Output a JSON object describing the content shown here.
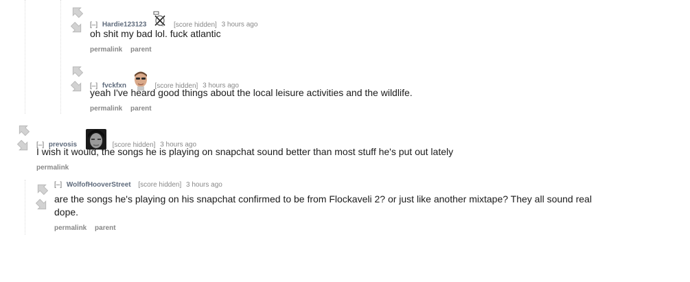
{
  "comments": [
    {
      "collapse": "[–]",
      "author": "Hardie123123",
      "flair_icon": "crossed-x-sketch-flair-icon",
      "score": "[score hidden]",
      "time": "3 hours ago",
      "body": "oh shit my bad lol. fuck atlantic",
      "buttons": [
        "permalink",
        "parent"
      ]
    },
    {
      "collapse": "[–]",
      "author": "fvckfxn",
      "flair_icon": "face-with-sunglasses-flair-icon",
      "score": "[score hidden]",
      "time": "3 hours ago",
      "body": "yeah I've heard good things about the local leisure activities and the wildlife.",
      "buttons": [
        "permalink",
        "parent"
      ]
    },
    {
      "collapse": "[–]",
      "author": "prevosis",
      "flair_icon": "hooded-face-flair-icon",
      "score": "[score hidden]",
      "time": "3 hours ago",
      "body": "I wish it would, the songs he is playing on snapchat sound better than most stuff he's put out lately",
      "buttons": [
        "permalink"
      ]
    },
    {
      "collapse": "[–]",
      "author": "WolfofHooverStreet",
      "score": "[score hidden]",
      "time": "3 hours ago",
      "body": "are the songs he's playing on his snapchat confirmed to be from Flockaveli 2? or just like another mixtape? They all sound real dope.",
      "buttons": [
        "permalink",
        "parent"
      ]
    }
  ],
  "colors": {
    "author": "#5f6b7c",
    "meta": "#888888",
    "arrow": "#c7c7c7",
    "thread_line": "#dcdcdc"
  },
  "icons": {
    "upvote": "upvote-arrow-icon",
    "downvote": "downvote-arrow-icon"
  }
}
